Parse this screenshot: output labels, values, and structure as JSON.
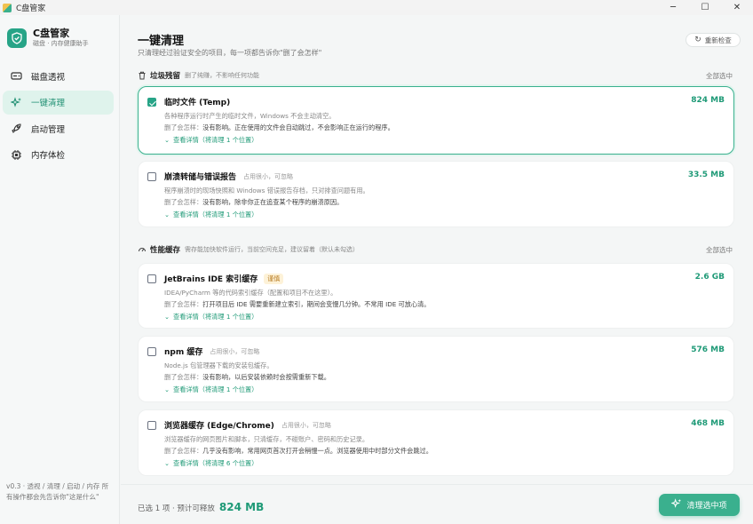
{
  "window": {
    "title": "C盘管家",
    "minimize": "─",
    "maximize": "☐",
    "close": "✕"
  },
  "brand": {
    "name": "C盘管家",
    "tagline": "磁盘 · 内存健康助手"
  },
  "nav": [
    {
      "label": "磁盘透视",
      "icon": "disk-icon"
    },
    {
      "label": "一键清理",
      "icon": "sparkle-icon",
      "active": true
    },
    {
      "label": "启动管理",
      "icon": "rocket-icon"
    },
    {
      "label": "内存体检",
      "icon": "chip-icon"
    }
  ],
  "sidebar_footer": "v0.3 · 透视 / 清理 / 启动 / 内存 所有操作都会先告诉你\"这是什么\"",
  "header": {
    "title": "一键清理",
    "subtitle": "只清理经过验证安全的项目，每一项都告诉你\"删了会怎样\"",
    "rescan": "重新检查"
  },
  "sections": [
    {
      "title": "垃圾残留",
      "desc": "删了纯赚，不影响任何功能",
      "select_all": "全部选中",
      "icon": "trash-icon"
    },
    {
      "title": "性能缓存",
      "desc": "需存能加快软件运行，当前空间充足，建议留着（默认未勾选）",
      "select_all": "全部选中",
      "icon": "gauge-icon"
    }
  ],
  "items": [
    {
      "name": "临时文件 (Temp)",
      "tag": "",
      "badge": "",
      "size": "824 MB",
      "checked": true,
      "desc": "各种程序运行时产生的临时文件，Windows 不会主动清空。",
      "effect_key": "删了会怎样：",
      "effect": "没有影响。正在使用的文件会自动跳过，不会影响正在运行的程序。",
      "more": "查看详情（将清理 1 个位置）"
    },
    {
      "name": "崩溃转储与错误报告",
      "tag": "占用很小，可忽略",
      "badge": "",
      "size": "33.5 MB",
      "checked": false,
      "desc": "程序崩溃时的现场快照和 Windows 错误报告存档，只对排查问题有用。",
      "effect_key": "删了会怎样：",
      "effect": "没有影响，除非你正在追查某个程序的崩溃原因。",
      "more": "查看详情（将清理 1 个位置）"
    },
    {
      "name": "JetBrains IDE 索引缓存",
      "tag": "",
      "badge": "谨慎",
      "size": "2.6 GB",
      "checked": false,
      "desc": "IDEA/PyCharm 等的代码索引缓存（配置和项目不在这里）。",
      "effect_key": "删了会怎样：",
      "effect": "打开项目后 IDE 需要重新建立索引，期间会变慢几分钟。不常用 IDE 可放心清。",
      "more": "查看详情（将清理 1 个位置）"
    },
    {
      "name": "npm 缓存",
      "tag": "占用很小，可忽略",
      "badge": "",
      "size": "576 MB",
      "checked": false,
      "desc": "Node.js 包管理器下载的安装包缓存。",
      "effect_key": "删了会怎样：",
      "effect": "没有影响，以后安装依赖时会按需重新下载。",
      "more": "查看详情（将清理 1 个位置）"
    },
    {
      "name": "浏览器缓存 (Edge/Chrome)",
      "tag": "占用很小，可忽略",
      "badge": "",
      "size": "468 MB",
      "checked": false,
      "desc": "浏览器缓存的网页图片和脚本，只清缓存，不碰账户、密码和历史记录。",
      "effect_key": "删了会怎样：",
      "effect": "几乎没有影响，常用网页首次打开会稍慢一点。浏览器使用中时部分文件会跳过。",
      "more": "查看详情（将清理 6 个位置）"
    }
  ],
  "footer": {
    "summary": "已选 1 项 · 预计可释放",
    "amount": "824 MB",
    "clean_button": "清理选中项"
  },
  "colors": {
    "accent": "#3ab08e",
    "accent_dark": "#1f9a77",
    "badge_bg": "#fdf2d8"
  }
}
